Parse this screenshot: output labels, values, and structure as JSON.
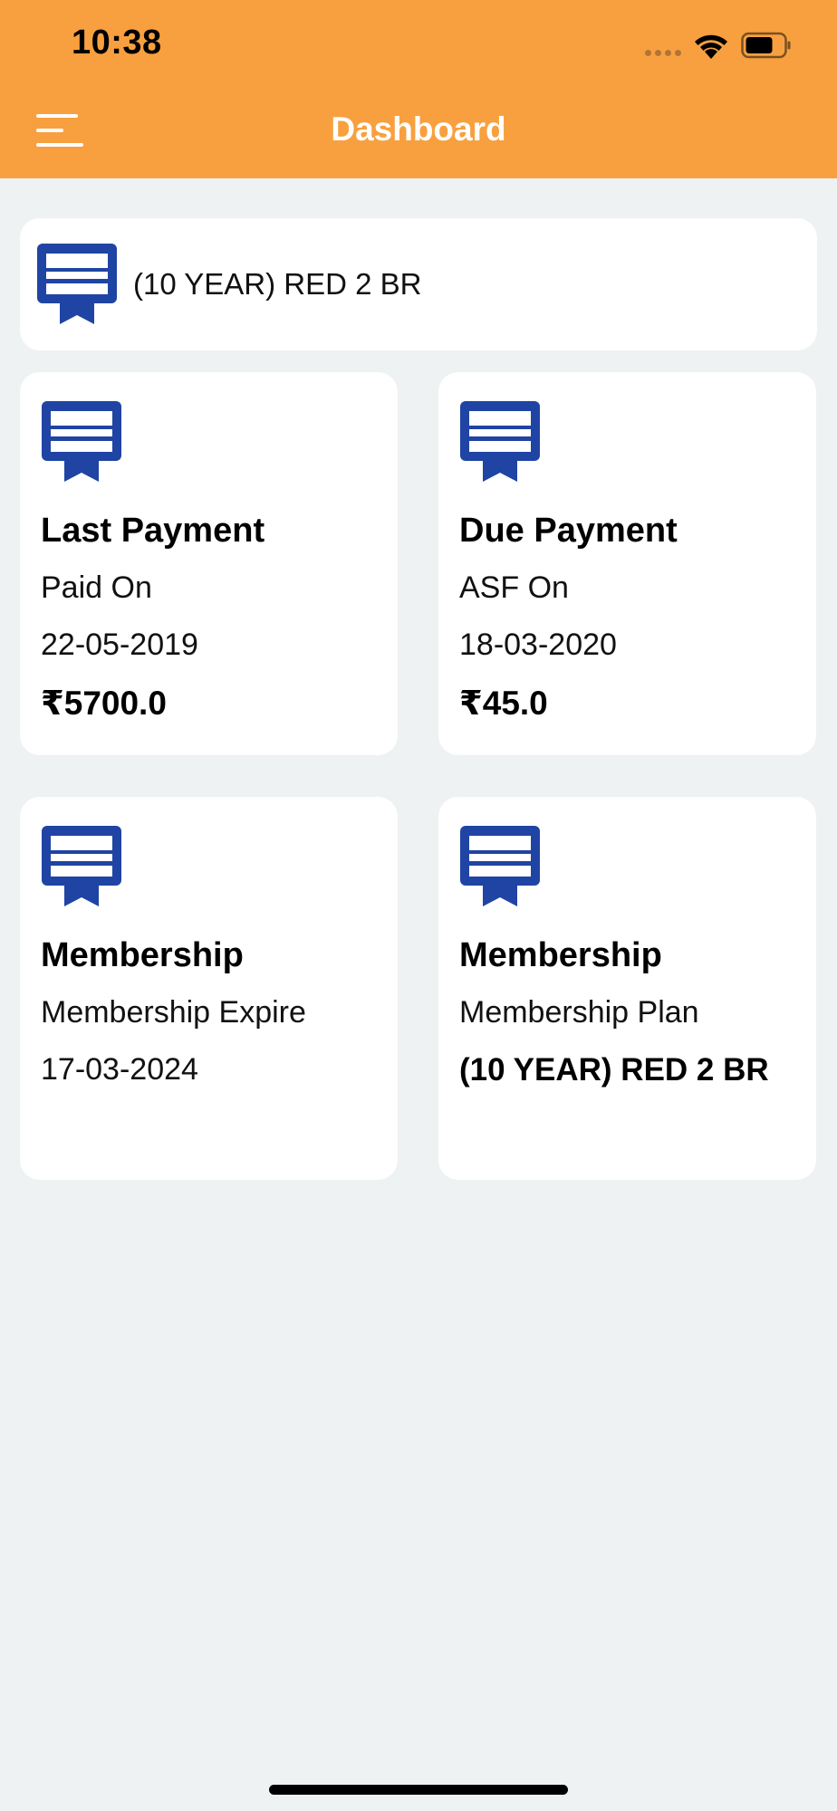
{
  "status_bar": {
    "time": "10:38"
  },
  "header": {
    "title": "Dashboard",
    "menu_icon": "hamburger-menu-icon",
    "background_color": "#f8a03f"
  },
  "plan_banner": {
    "icon": "membership-card-icon",
    "text": "(10 YEAR) RED 2 BR"
  },
  "cards": {
    "last_payment": {
      "title": "Last Payment",
      "label": "Paid On",
      "date": "22-05-2019",
      "amount": "₹5700.0"
    },
    "due_payment": {
      "title": "Due Payment",
      "label": "ASF On",
      "date": "18-03-2020",
      "amount": "₹45.0"
    },
    "membership_expire": {
      "title": "Membership",
      "label": "Membership Expire",
      "date": "17-03-2024"
    },
    "membership_plan": {
      "title": "Membership",
      "label": "Membership Plan",
      "plan": "(10 YEAR) RED 2 BR"
    }
  },
  "colors": {
    "accent": "#f8a03f",
    "icon_blue": "#1f44a3",
    "background": "#eef2f3"
  }
}
